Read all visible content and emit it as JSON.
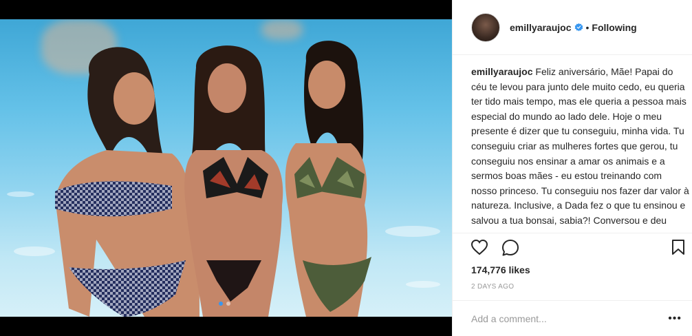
{
  "post": {
    "username": "emillyaraujoc",
    "follow_separator": "•",
    "follow_status": "Following",
    "caption_user": "emillyaraujoc",
    "caption_text": "Feliz aniversário, Mãe! Papai do céu te levou para junto dele muito cedo, eu queria ter tido mais tempo, mas ele queria a pessoa mais especial do mundo ao lado dele. Hoje o meu presente é dizer que tu conseguiu, minha vida. Tu conseguiu criar as mulheres fortes que gerou, tu conseguiu nos ensinar a amar os animais e a sermos boas mães - eu estou treinando com nosso princeso. Tu conseguiu nos fazer dar valor à natureza. Inclusive, a Dada fez o que tu ensinou e salvou a tua bonsai, sabia?! Conversou e deu carinho até ela",
    "likes": "174,776 likes",
    "time": "2 DAYS AGO",
    "comment_placeholder": "Add a comment...",
    "more": "•••"
  },
  "media": {
    "slide_count": 2,
    "active_slide": 1
  },
  "icons": {
    "verified": "verified-badge-icon",
    "like": "heart-icon",
    "comment": "comment-bubble-icon",
    "save": "bookmark-icon"
  },
  "colors": {
    "verified": "#3897f0",
    "text": "#262626",
    "muted": "#999999",
    "border": "#efefef"
  }
}
